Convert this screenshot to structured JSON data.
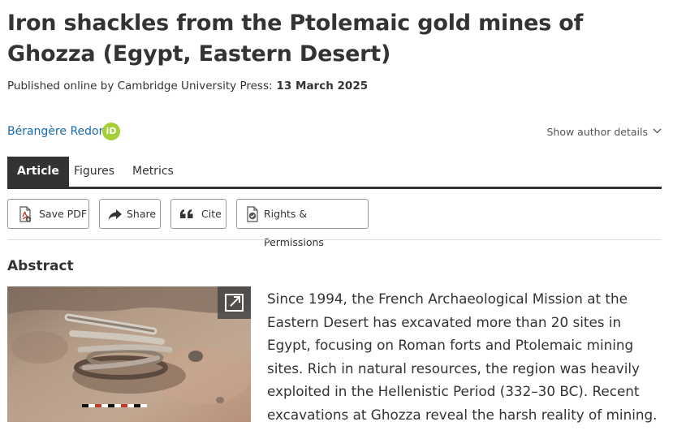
{
  "article": {
    "title": "Iron shackles from the Ptolemaic gold mines of Ghozza (Egypt, Eastern Desert)",
    "published_prefix": "Published online by Cambridge University Press:",
    "published_date": "13 March 2025"
  },
  "author": {
    "name": "Bérangère Redon",
    "orcid_label": "iD",
    "details_label": "Show author details"
  },
  "tabs": [
    {
      "label": "Article",
      "active": true
    },
    {
      "label": "Figures",
      "active": false
    },
    {
      "label": "Metrics",
      "active": false
    }
  ],
  "actions": {
    "save_pdf": "Save PDF",
    "share": "Share",
    "cite": "Cite",
    "rights": "Rights & Permissions"
  },
  "abstract": {
    "heading": "Abstract",
    "text": "Since 1994, the French Archaeological Mission at the Eastern Desert has excavated more than 20 sites in Egypt, focusing on Roman forts and Ptolemaic mining sites. Rich in natural resources, the region was heavily exploited in the Hellenistic Period (332–30 BC). Recent excavations at Ghozza reveal the harsh reality of mining."
  },
  "colors": {
    "link": "#1a6bab",
    "orcid": "#a6ce39",
    "text": "#333333",
    "active_tab": "#333333"
  }
}
